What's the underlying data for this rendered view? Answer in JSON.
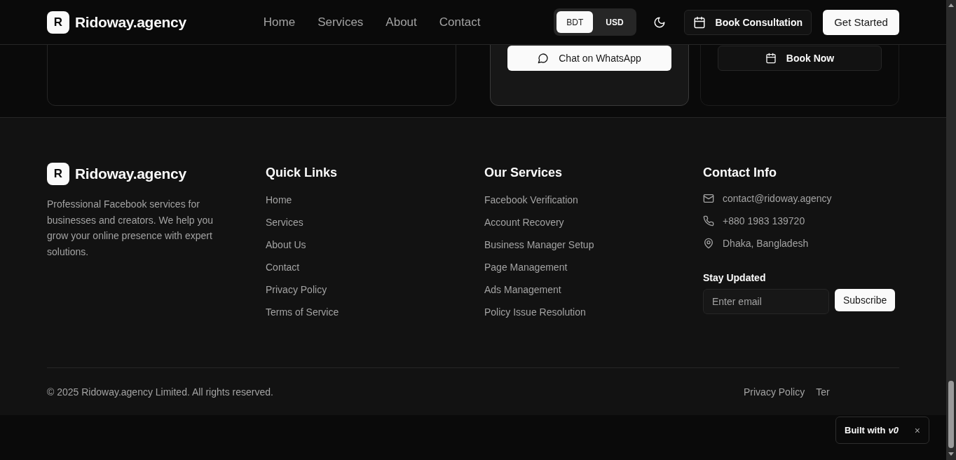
{
  "header": {
    "logo_letter": "R",
    "brand": "Ridoway.agency",
    "nav": [
      {
        "label": "Home"
      },
      {
        "label": "Services"
      },
      {
        "label": "About"
      },
      {
        "label": "Contact"
      }
    ],
    "currency": [
      {
        "label": "BDT",
        "selected": true
      },
      {
        "label": "USD",
        "selected": false
      }
    ],
    "book_button": "Book Consultation",
    "cta": "Get Started"
  },
  "cards": [
    {
      "kind": "empty"
    },
    {
      "kind": "whatsapp",
      "button": "Chat on WhatsApp"
    },
    {
      "kind": "booking",
      "button": "Book Now"
    }
  ],
  "footer": {
    "logo_letter": "R",
    "brand": "Ridoway.agency",
    "description": "Professional Facebook services for businesses and creators. We help you grow your online presence with expert solutions.",
    "columns": [
      {
        "title": "Quick Links",
        "links": [
          "Home",
          "Services",
          "About Us",
          "Contact",
          "Privacy Policy",
          "Terms of Service"
        ]
      },
      {
        "title": "Our Services",
        "links": [
          "Facebook Verification",
          "Account Recovery",
          "Business Manager Setup",
          "Page Management",
          "Ads Management",
          "Policy Issue Resolution"
        ]
      }
    ],
    "contact": {
      "title": "Contact Info",
      "items": [
        {
          "kind": "email",
          "text": "contact@ridoway.agency"
        },
        {
          "kind": "phone",
          "text": "+880 1983 139720"
        },
        {
          "kind": "location",
          "text": "Dhaka, Bangladesh"
        }
      ]
    },
    "newsletter": {
      "title": "Stay Updated",
      "placeholder": "Enter email",
      "button": "Subscribe"
    },
    "copyright": "© 2025 Ridoway.agency Limited. All rights reserved.",
    "legal_links": [
      "Privacy Policy",
      "Ter"
    ]
  },
  "badge": {
    "text": "Built with",
    "logo": "v0",
    "close": "×"
  }
}
